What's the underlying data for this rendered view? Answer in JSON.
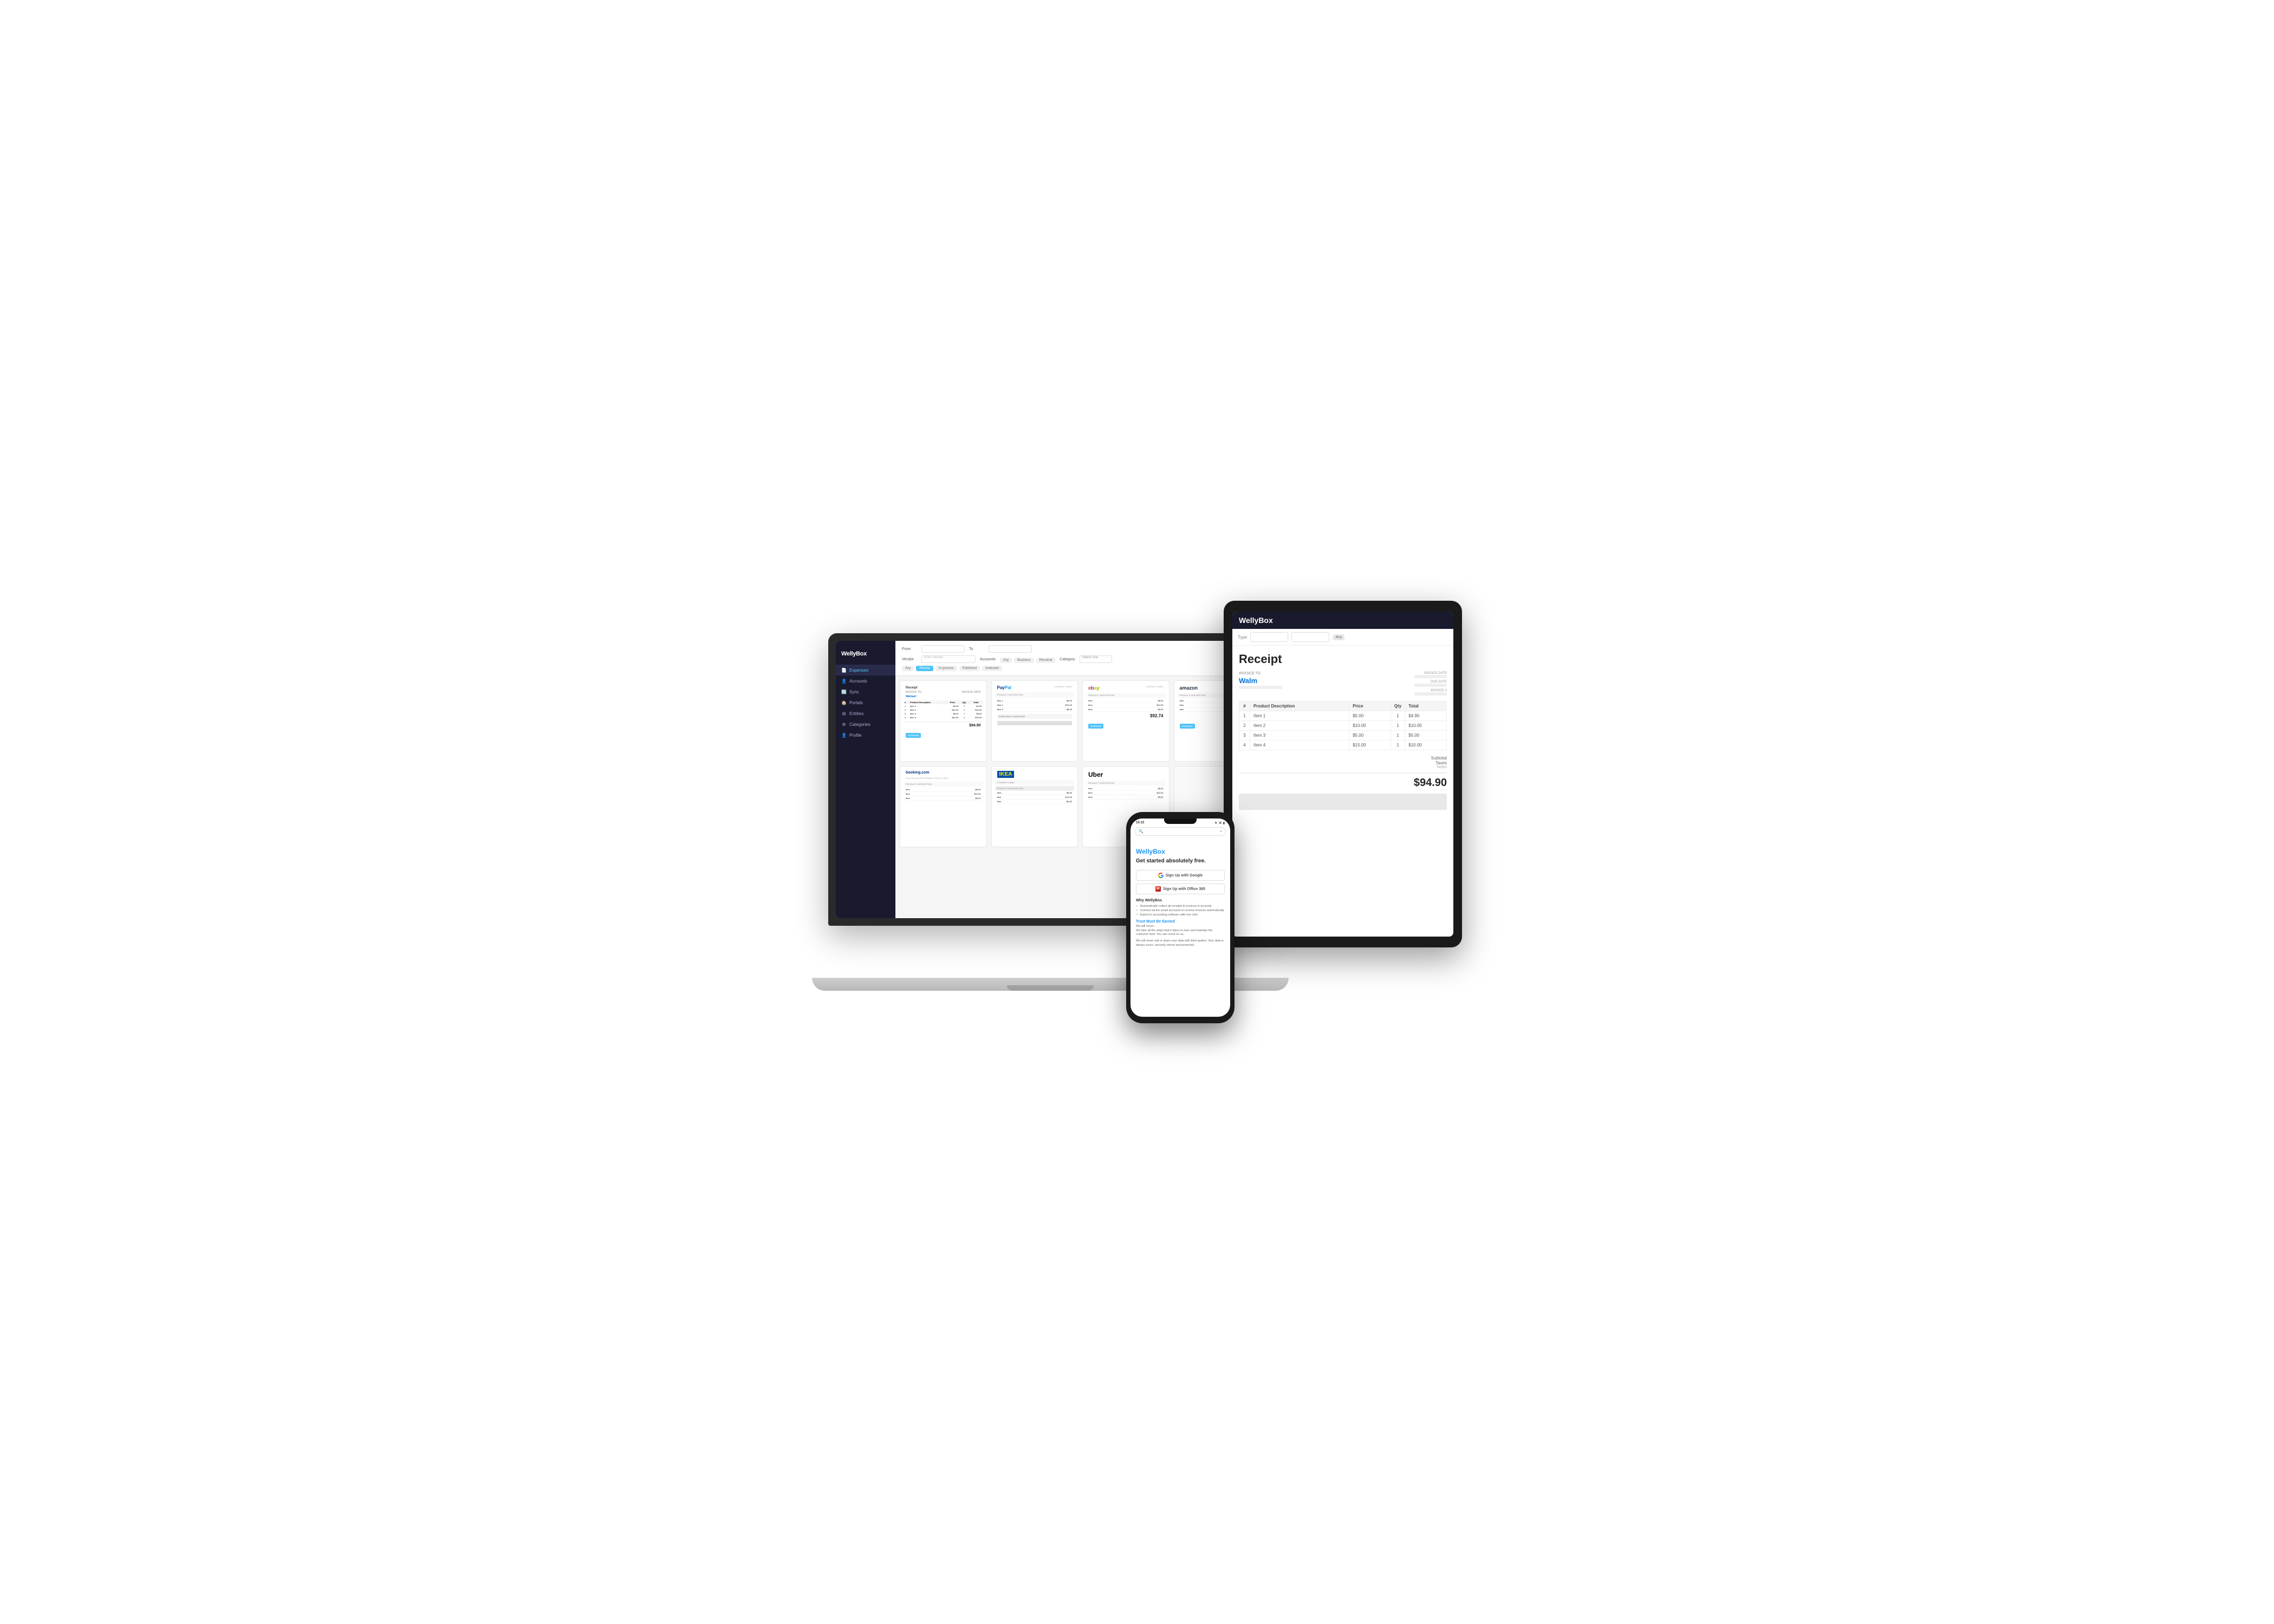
{
  "scene": {
    "background": "#ffffff"
  },
  "laptop": {
    "brand": "WellyBox",
    "sidebar": {
      "items": [
        {
          "label": "Expenses",
          "icon": "📄",
          "active": true
        },
        {
          "label": "Accounts",
          "icon": "👤",
          "active": false
        },
        {
          "label": "Sync",
          "icon": "🔄",
          "active": false
        },
        {
          "label": "Portals",
          "icon": "🏠",
          "active": false
        },
        {
          "label": "Entities",
          "icon": "⊞",
          "active": false
        },
        {
          "label": "Categories",
          "icon": "⚙",
          "active": false
        },
        {
          "label": "Profile",
          "icon": "👤",
          "active": false
        }
      ]
    },
    "filters": {
      "from_label": "From",
      "to_label": "To",
      "vendor_label": "Vendor",
      "vendor_placeholder": "Enter Vendor",
      "accounts_label": "Accounts",
      "category_label": "Category",
      "category_placeholder": "Select One",
      "type_tabs": [
        "Any",
        "Business",
        "Personal"
      ],
      "status_tabs": [
        "Any",
        "Review",
        "In process",
        "Published",
        "Irrelevant"
      ]
    },
    "receipts": [
      {
        "company": "Receipt",
        "total": "$94.90",
        "logo_type": "receipt"
      },
      {
        "company": "PayPal",
        "total": "",
        "logo_type": "paypal"
      },
      {
        "company": "eBay",
        "total": "",
        "logo_type": "ebay"
      },
      {
        "company": "amazon",
        "total": "",
        "logo_type": "amazon"
      },
      {
        "company": "booking.com",
        "total": "",
        "logo_type": "booking"
      },
      {
        "company": "IKEA",
        "total": "",
        "logo_type": "ikea"
      },
      {
        "company": "Uber",
        "total": "",
        "logo_type": "uber"
      }
    ]
  },
  "tablet": {
    "brand": "WellyBox",
    "receipt": {
      "title": "Receipt",
      "invoice_to_label": "INVOICE TO",
      "company": "Walm",
      "invoice_date_label": "INVOICE DATE",
      "due_date_label": "DUE DATE",
      "invoice_num_label": "INVOICE #",
      "table_headers": [
        "#",
        "Product Description",
        "Price",
        "Qty",
        "Total"
      ],
      "items": [
        {
          "num": "1",
          "desc": "Item 1",
          "price": "$5.00",
          "qty": "1",
          "total": "$4.90"
        },
        {
          "num": "2",
          "desc": "Item 2",
          "price": "$10.00",
          "qty": "1",
          "total": "$10.00"
        },
        {
          "num": "3",
          "desc": "Item 3",
          "price": "$5.00",
          "qty": "1",
          "total": "$5.00"
        },
        {
          "num": "4",
          "desc": "Item 4",
          "price": "$15.00",
          "qty": "1",
          "total": "$10.00"
        }
      ],
      "subtotal_label": "Subtotal",
      "taxes_label": "Taxes",
      "notes_label": "Notes",
      "grand_total": "$94.90"
    }
  },
  "phone": {
    "time": "10:10",
    "brand": "WellyBox",
    "tagline": "Get started\nabsolutely free.",
    "sign_up_google": "Sign Up with Google",
    "sign_up_office": "Sign Up with Office 365",
    "why_title": "Why WellyBox",
    "why_items": [
      "Automatically collect all receipts & invoices in seconds",
      "Connect all the email accounts to receive invoices automatically",
      "Export to accounting software with one click"
    ],
    "trust_title": "Trust Must Be Earned",
    "trust_subtitle": "We will never...",
    "trust_text": "We take all the steps that it takes to earn and maintain the customer trust. You can count on us.",
    "trust_detail": "We will never sell or share your data with third parties. Your data is always yours, securely stored and protected."
  }
}
